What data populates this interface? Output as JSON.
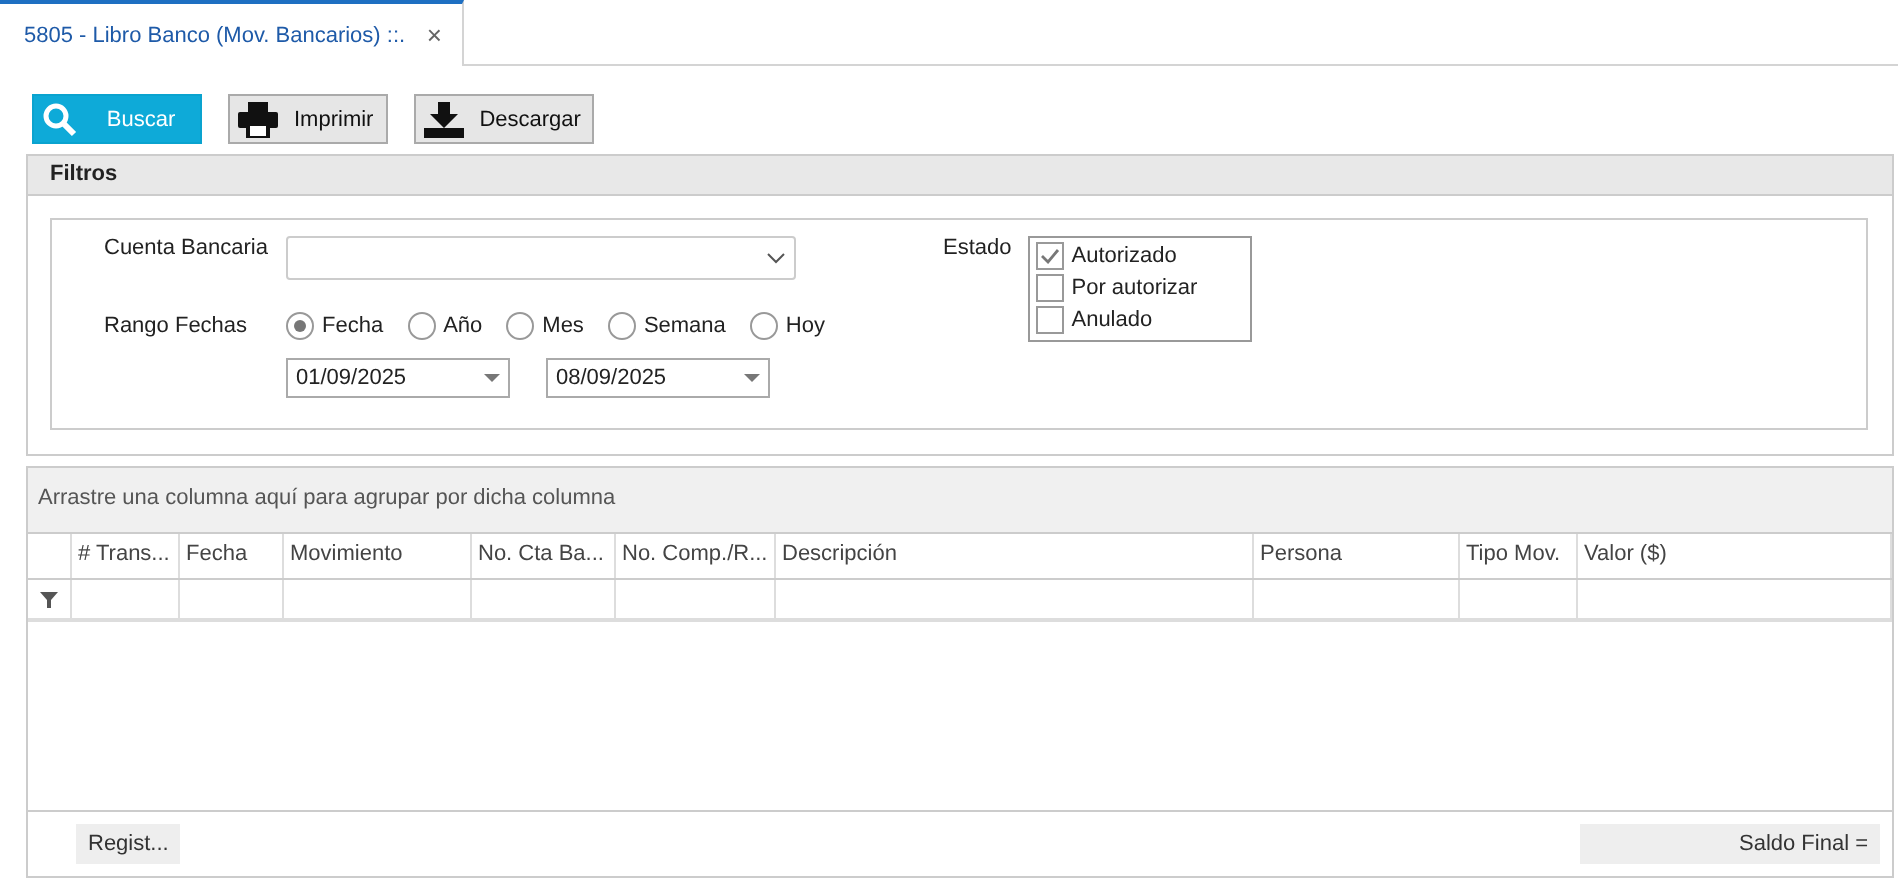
{
  "tabs": [
    {
      "label": "5805 - Libro Banco (Mov. Bancarios) ::.",
      "selected": true,
      "close": "×"
    }
  ],
  "toolbar": [
    {
      "label": "Buscar",
      "kind": "search",
      "selected": true
    },
    {
      "label": "Imprimir",
      "kind": "print",
      "selected": false
    },
    {
      "label": "Descargar",
      "kind": "download",
      "selected": false
    }
  ],
  "filters": {
    "title": "Filtros",
    "account": {
      "label": "Cuenta Bancaria"
    },
    "range": {
      "label": "Rango Fechas",
      "options": [
        {
          "label": "Fecha",
          "selected": true
        },
        {
          "label": "Año",
          "selected": false
        },
        {
          "label": "Mes",
          "selected": false
        },
        {
          "label": "Semana",
          "selected": false
        },
        {
          "label": "Hoy",
          "selected": false
        }
      ],
      "from": "01/09/2025",
      "to": "08/09/2025"
    },
    "status": {
      "label": "Estado",
      "options": [
        {
          "label": "Autorizado",
          "checked": true
        },
        {
          "label": "Por autorizar",
          "checked": false
        },
        {
          "label": "Anulado",
          "checked": false
        }
      ]
    }
  },
  "grid": {
    "group_hint": "Arrastre una columna aquí para agrupar por dicha columna",
    "columns": [
      "# Trans...",
      "Fecha",
      "Movimiento",
      "No. Cta Ba...",
      "No. Comp./R...",
      "Descripción",
      "Persona",
      "Tipo Mov.",
      "Valor ($)"
    ],
    "footer": {
      "count": "Regist...",
      "balance": "Saldo Final ="
    }
  }
}
